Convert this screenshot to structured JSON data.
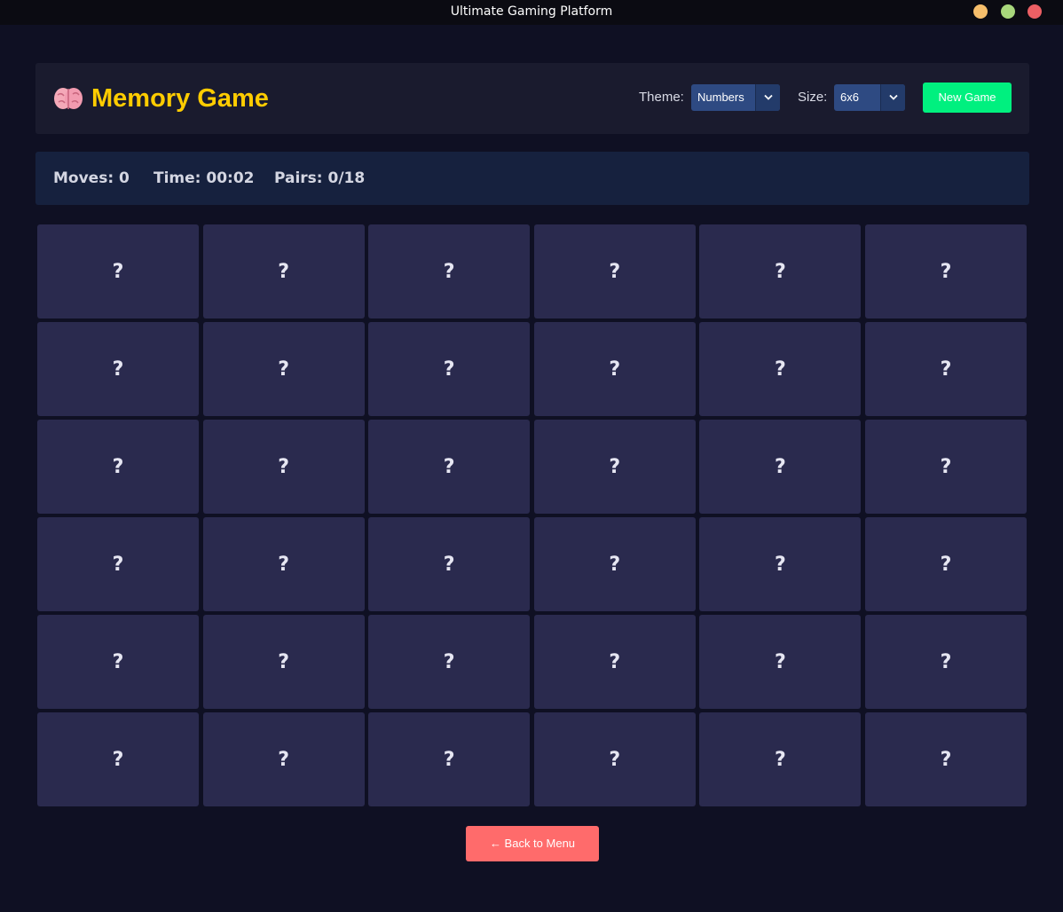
{
  "window": {
    "title": "Ultimate Gaming Platform",
    "controls": {
      "minimize_color": "#f6be6b",
      "maximize_color": "#a8d77c",
      "close_color": "#ec5f64"
    }
  },
  "header": {
    "icon": "brain-icon",
    "title": "Memory Game",
    "title_color": "#ffcc00",
    "theme_label": "Theme:",
    "theme_value": "Numbers",
    "size_label": "Size:",
    "size_value": "6x6",
    "new_game_label": "New Game",
    "new_game_color": "#00f07f"
  },
  "stats": {
    "moves": "Moves: 0",
    "time": "Time: 00:02",
    "pairs": "Pairs: 0/18"
  },
  "board": {
    "rows": 6,
    "cols": 6,
    "cards": [
      [
        "?",
        "?",
        "?",
        "?",
        "?",
        "?"
      ],
      [
        "?",
        "?",
        "?",
        "?",
        "?",
        "?"
      ],
      [
        "?",
        "?",
        "?",
        "?",
        "?",
        "?"
      ],
      [
        "?",
        "?",
        "?",
        "?",
        "?",
        "?"
      ],
      [
        "?",
        "?",
        "?",
        "?",
        "?",
        "?"
      ],
      [
        "?",
        "?",
        "?",
        "?",
        "?",
        "?"
      ]
    ]
  },
  "footer": {
    "back_label": "← Back to Menu",
    "back_color": "#ff6b6b"
  }
}
